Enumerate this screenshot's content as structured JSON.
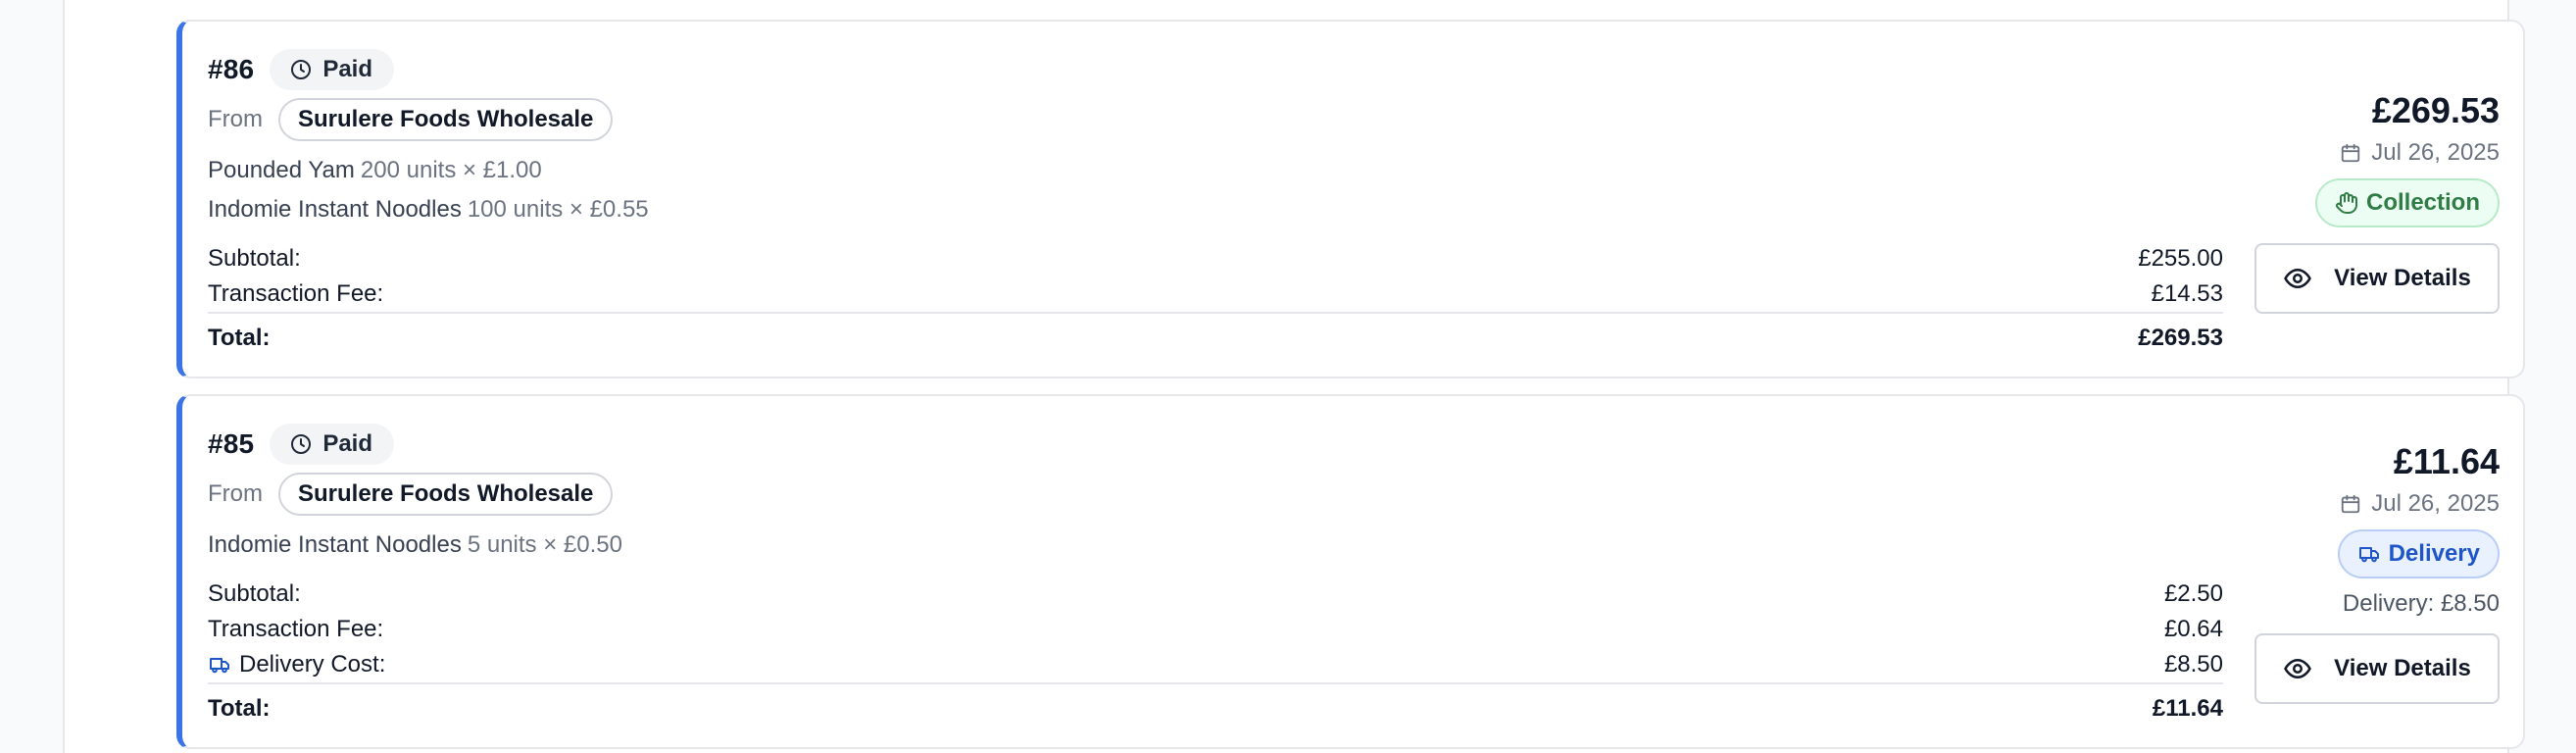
{
  "orders": [
    {
      "id": "#86",
      "status": "Paid",
      "from_label": "From",
      "seller": "Surulere Foods Wholesale",
      "items": [
        {
          "name": "Pounded Yam",
          "qty": "200 units × £1.00"
        },
        {
          "name": "Indomie Instant Noodles",
          "qty": "100 units × £0.55"
        }
      ],
      "subtotal_label": "Subtotal:",
      "subtotal": "£255.00",
      "fee_label": "Transaction Fee:",
      "fee": "£14.53",
      "total_label": "Total:",
      "total": "£269.53",
      "amount": "£269.53",
      "date": "Jul 26, 2025",
      "method": "Collection",
      "view_label": "View Details"
    },
    {
      "id": "#85",
      "status": "Paid",
      "from_label": "From",
      "seller": "Surulere Foods Wholesale",
      "items": [
        {
          "name": "Indomie Instant Noodles",
          "qty": "5 units × £0.50"
        }
      ],
      "subtotal_label": "Subtotal:",
      "subtotal": "£2.50",
      "fee_label": "Transaction Fee:",
      "fee": "£0.64",
      "delivery_label": "Delivery Cost:",
      "delivery": "£8.50",
      "total_label": "Total:",
      "total": "£11.64",
      "amount": "£11.64",
      "date": "Jul 26, 2025",
      "method": "Delivery",
      "delivery_note": "Delivery: £8.50",
      "view_label": "View Details"
    }
  ],
  "colors": {
    "accent_border": "#3b74e6",
    "collection_green": "#2f7d45",
    "delivery_blue": "#1e55c9"
  },
  "icons": {
    "status": "clock-icon",
    "date": "calendar-icon",
    "collection": "hand-icon",
    "delivery": "truck-icon",
    "view": "eye-icon"
  }
}
